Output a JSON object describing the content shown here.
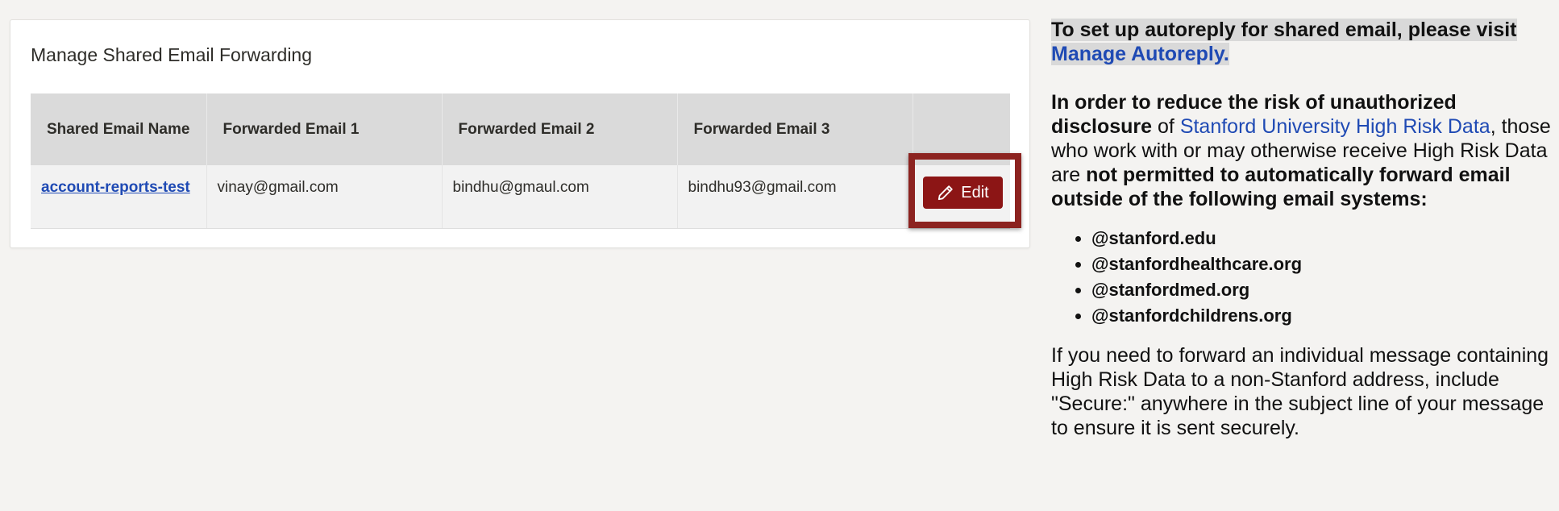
{
  "card": {
    "title": "Manage Shared Email Forwarding"
  },
  "table": {
    "headers": [
      "Shared Email Name",
      "Forwarded Email 1",
      "Forwarded Email 2",
      "Forwarded Email 3",
      ""
    ],
    "rows": [
      {
        "name": "account-reports-test",
        "email1": "vinay@gmail.com",
        "email2": "bindhu@gmaul.com",
        "email3": "bindhu93@gmail.com",
        "action_label": "Edit"
      }
    ]
  },
  "icons": {
    "edit": "pencil-icon"
  },
  "colors": {
    "accent": "#8c1515",
    "link": "#1f4ab4"
  },
  "side": {
    "autoreply_text": "To set up autoreply for shared email, please visit",
    "autoreply_link": "Manage Autoreply.",
    "p2_bold1": "In order to reduce the risk of unauthorized disclosure",
    "p2_text1": " of ",
    "p2_link": "Stanford University High Risk Data",
    "p2_text2": ", those who work with or may otherwise receive High Risk Data are ",
    "p2_bold2": "not permitted to automatically forward email outside of the following email systems:",
    "domains": [
      "@stanford.edu",
      "@stanfordhealthcare.org",
      "@stanfordmed.org",
      "@stanfordchildrens.org"
    ],
    "p3": "If you need to forward an individual message containing High Risk Data to a non-Stanford address, include \"Secure:\" anywhere in the subject line of your message to ensure it is sent securely."
  }
}
